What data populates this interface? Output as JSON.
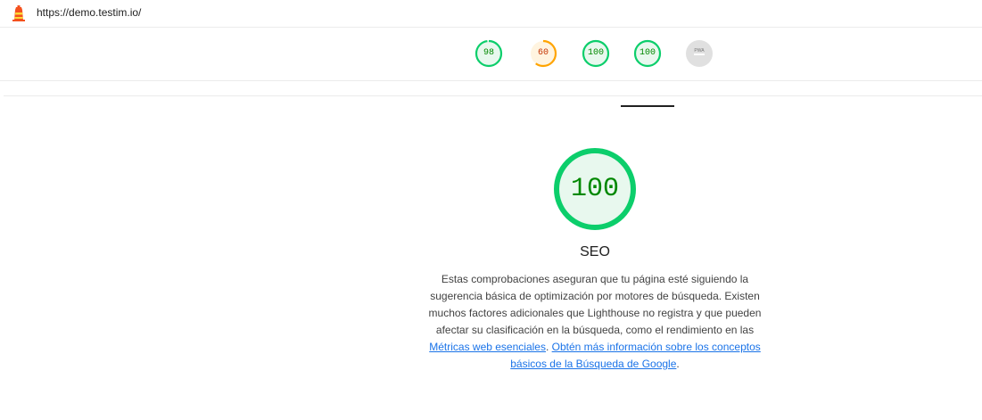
{
  "header": {
    "url": "https://demo.testim.io/",
    "logo_icon": "lighthouse-icon"
  },
  "gauges": [
    {
      "score": "98",
      "value": 0.98,
      "color": "#0cce6b",
      "fill": "#e8f8ee",
      "text_color": "#008800",
      "name": "gauge-performance"
    },
    {
      "score": "60",
      "value": 0.6,
      "color": "#ffa400",
      "fill": "#fff4e0",
      "text_color": "#c33300",
      "name": "gauge-accessibility"
    },
    {
      "score": "100",
      "value": 1.0,
      "color": "#0cce6b",
      "fill": "#e8f8ee",
      "text_color": "#008800",
      "name": "gauge-best-practices"
    },
    {
      "score": "100",
      "value": 1.0,
      "color": "#0cce6b",
      "fill": "#e8f8ee",
      "text_color": "#008800",
      "name": "gauge-seo"
    },
    {
      "score": "PWA",
      "value": 0,
      "color": "#cccccc",
      "fill": "#e0e0e0",
      "text_color": "#757575",
      "name": "gauge-pwa"
    }
  ],
  "main": {
    "score": "100",
    "score_value": 1.0,
    "color": "#0cce6b",
    "fill": "#e8f8ee",
    "title": "SEO",
    "description_text": "Estas comprobaciones aseguran que tu página esté siguiendo la sugerencia básica de optimización por motores de búsqueda. Existen muchos factores adicionales que Lighthouse no registra y que pueden afectar su clasificación en la búsqueda, como el rendimiento en las ",
    "link1": "Métricas web esenciales",
    "separator": ". ",
    "link2": "Obtén más información sobre los conceptos básicos de la Búsqueda de Google",
    "end": "."
  }
}
